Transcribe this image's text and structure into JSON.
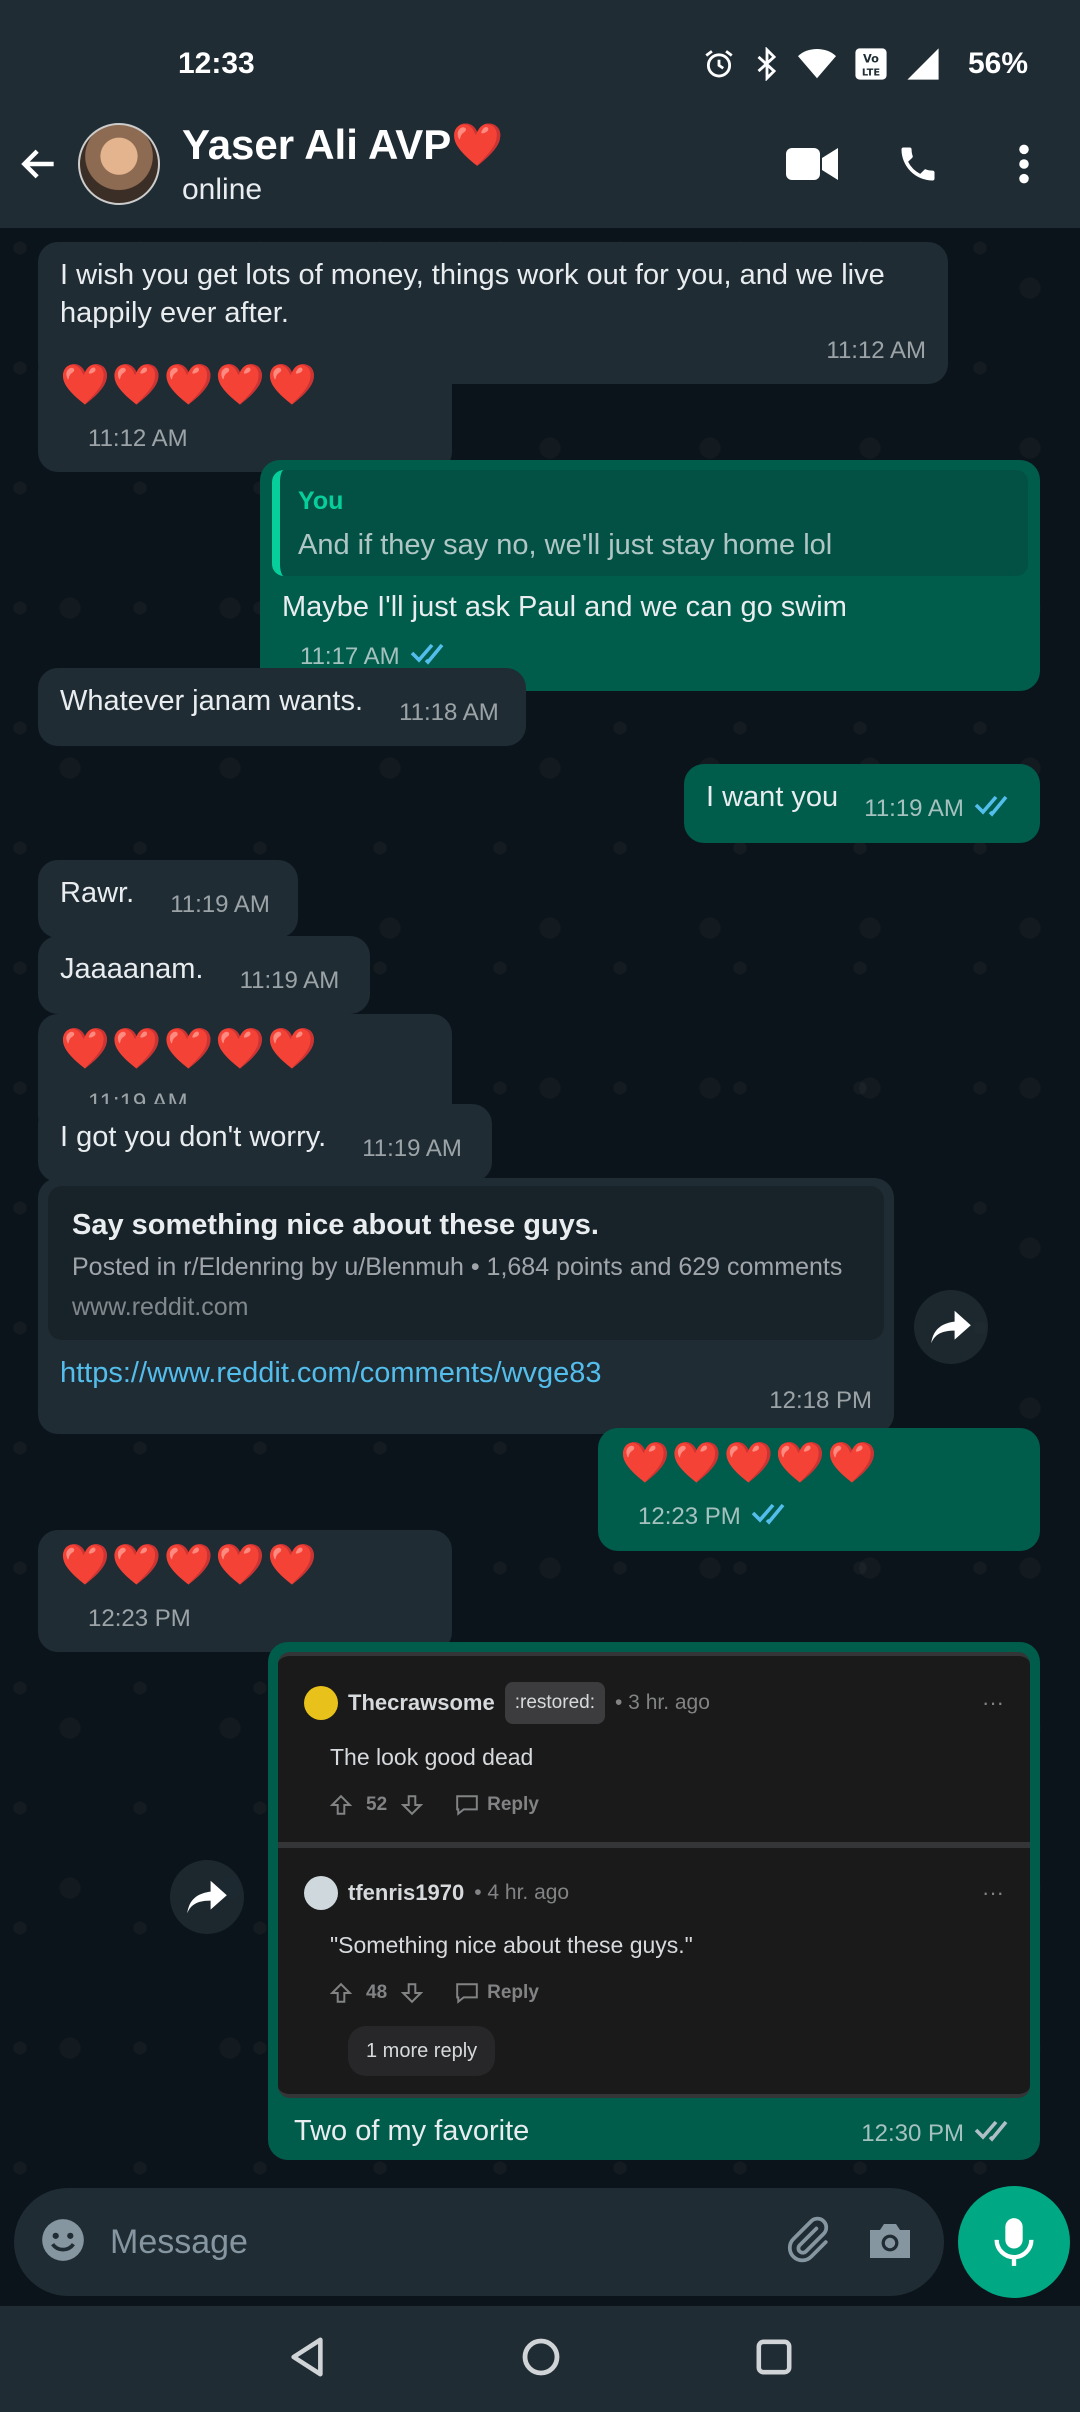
{
  "status_bar": {
    "time": "12:33",
    "battery": "56%"
  },
  "header": {
    "contact_name": "Yaser Ali AVP❤️",
    "contact_status": "online"
  },
  "messages": {
    "m1": {
      "text": "I wish you get lots of money, things work out for you, and we live happily ever after.",
      "time": "11:12 AM"
    },
    "m2": {
      "text": "❤️❤️❤️❤️❤️",
      "time": "11:12 AM"
    },
    "m3": {
      "quote_author": "You",
      "quote_text": "And if they say no, we'll just stay home lol",
      "text": "Maybe I'll just ask Paul and we can go swim",
      "time": "11:17 AM"
    },
    "m4": {
      "text": "Whatever janam wants.",
      "time": "11:18 AM"
    },
    "m5": {
      "text": "I want you",
      "time": "11:19 AM"
    },
    "m6": {
      "text": "Rawr.",
      "time": "11:19 AM"
    },
    "m7": {
      "text": "Jaaaanam.",
      "time": "11:19 AM"
    },
    "m8": {
      "text": "❤️❤️❤️❤️❤️",
      "time": "11:19 AM"
    },
    "m9": {
      "text": "I got you don't worry.",
      "time": "11:19 AM"
    },
    "m10": {
      "link_title": "Say something nice about these guys.",
      "link_desc": "Posted in r/Eldenring by u/Blenmuh • 1,684 points and 629 comments",
      "link_domain": "www.reddit.com",
      "url": "https://www.reddit.com/comments/wvge83",
      "time": "12:18 PM"
    },
    "m11": {
      "text": "❤️❤️❤️❤️❤️",
      "time": "12:23 PM"
    },
    "m12": {
      "text": "❤️❤️❤️❤️❤️",
      "time": "12:23 PM"
    },
    "m13": {
      "comment1": {
        "user": "Thecrawsome",
        "flair": ":restored:",
        "age": "• 3 hr. ago",
        "text": "The look good dead",
        "votes": "52",
        "reply": "Reply"
      },
      "comment2": {
        "user": "tfenris1970",
        "age": "• 4 hr. ago",
        "text": "\"Something nice about these guys.\"",
        "votes": "48",
        "reply": "Reply",
        "more": "1 more reply"
      },
      "text": "Two of my favorite",
      "time": "12:30 PM"
    }
  },
  "composer": {
    "placeholder": "Message"
  },
  "colors": {
    "incoming": "#1f2c34",
    "outgoing": "#005c4b",
    "accent": "#00a884",
    "link": "#53bdeb",
    "read_tick": "#53bdeb"
  },
  "icons": [
    "back-arrow-icon",
    "video-call-icon",
    "phone-icon",
    "more-vert-icon",
    "forward-icon",
    "emoji-icon",
    "attach-icon",
    "camera-icon",
    "mic-icon",
    "nav-back-icon",
    "nav-home-icon",
    "nav-recents-icon"
  ]
}
